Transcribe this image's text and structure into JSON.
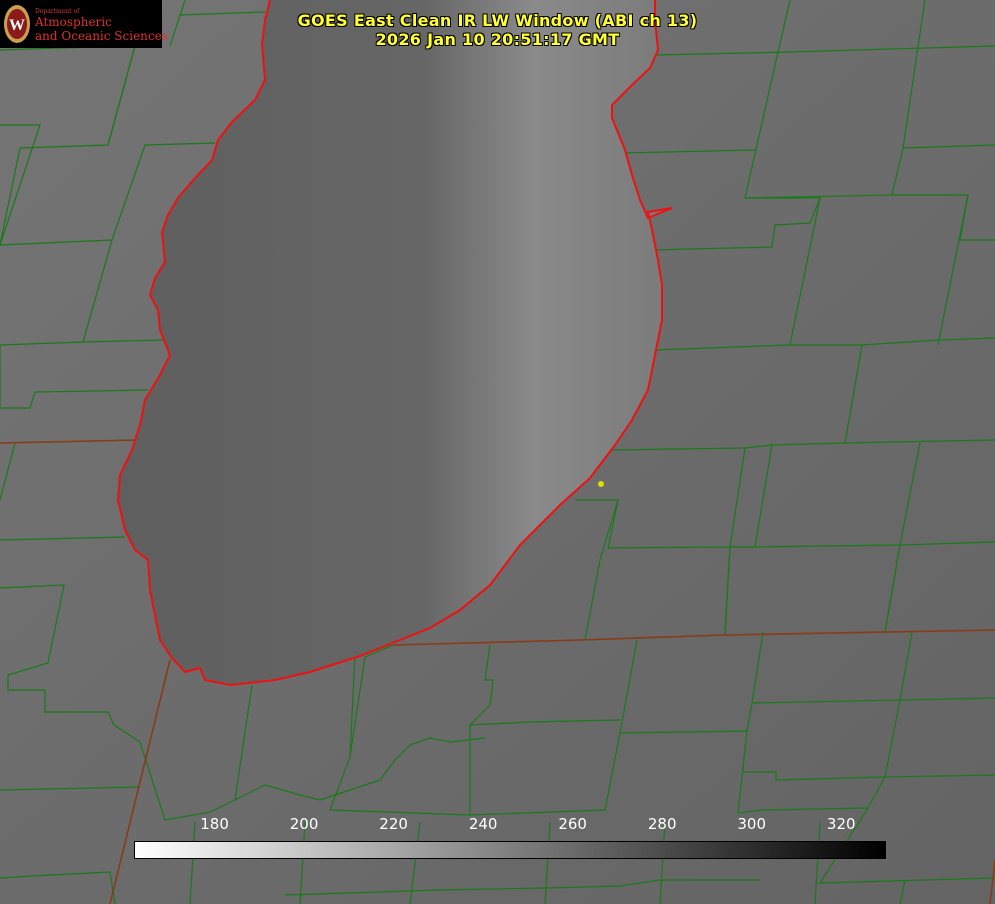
{
  "title": {
    "line1": "GOES East Clean IR LW Window (ABI ch 13)",
    "line2": "2026 Jan 10 20:51:17 GMT"
  },
  "logo": {
    "department": "Department of",
    "line1": "Atmospheric",
    "line2": "and Oceanic Sciences",
    "seal_letter": "W",
    "seal_color": "#8b1a1a"
  },
  "colorbar": {
    "ticks": [
      "180",
      "200",
      "220",
      "240",
      "260",
      "280",
      "300",
      "320"
    ],
    "min": 162,
    "max": 330,
    "low_color": "#ffffff",
    "high_color": "#000000"
  },
  "colors": {
    "land": "#6e6e6e",
    "lake": "#5e5e5e",
    "county_lines": "#1a7a1a",
    "state_lines": "#8b3a1a",
    "shoreline": "#ee1111",
    "title_text": "#ffff33",
    "station_marker": "#dddd00"
  }
}
